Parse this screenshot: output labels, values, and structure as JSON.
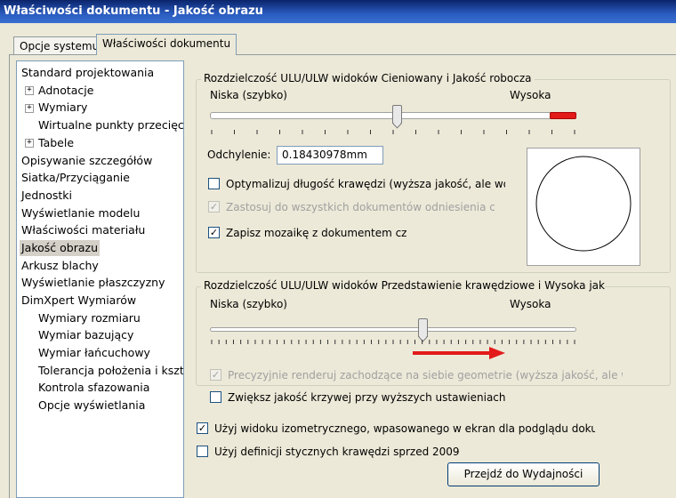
{
  "window": {
    "title": "Właściwości dokumentu - Jakość obrazu"
  },
  "tabs": [
    {
      "label": "Opcje systemu"
    },
    {
      "label": "Właściwości dokumentu"
    }
  ],
  "tree": {
    "items": [
      {
        "label": "Standard projektowania"
      },
      {
        "label": "Adnotacje"
      },
      {
        "label": "Wymiary"
      },
      {
        "label": "Wirtualne punkty przecięcia"
      },
      {
        "label": "Tabele"
      },
      {
        "label": "Opisywanie szczegółów"
      },
      {
        "label": "Siatka/Przyciąganie"
      },
      {
        "label": "Jednostki"
      },
      {
        "label": "Wyświetlanie modelu"
      },
      {
        "label": "Właściwości materiału"
      },
      {
        "label": "Jakość obrazu"
      },
      {
        "label": "Arkusz blachy"
      },
      {
        "label": "Wyświetlanie płaszczyzny"
      },
      {
        "label": "DimXpert Wymiarów"
      },
      {
        "label": "Wymiary rozmiaru"
      },
      {
        "label": "Wymiar bazujący"
      },
      {
        "label": "Wymiar łańcuchowy"
      },
      {
        "label": "Tolerancja położenia i kształtu"
      },
      {
        "label": "Kontrola sfazowania"
      },
      {
        "label": "Opcje wyświetlania"
      }
    ],
    "expander_plus": "+"
  },
  "shaded": {
    "title": "Rozdzielczość ULU/ULW widoków Cieniowany i Jakość robocza",
    "low_label": "Niska (szybko)",
    "high_label": "Wysoka",
    "slider_level": 0.55,
    "deviation_label": "Odchylenie:",
    "deviation_value": "0.18430978mm",
    "optimize_label": "Optymalizuj długość krawędzi (wyższa jakość, ale wolniej)",
    "optimize_checked": "",
    "apply_all_label": "Zastosuj do wszystkich dokumentów odniesienia części",
    "apply_all_checked": "✓",
    "save_tess_label": "Zapisz mozaikę z dokumentem części",
    "save_tess_checked": "✓"
  },
  "wireframe": {
    "title": "Rozdzielczość ULU/ULW widoków Przedstawienie krawędziowe i Wysoka jakość",
    "low_label": "Niska (szybko)",
    "high_label": "Wysoka",
    "slider_level": 0.58,
    "precise_label": "Precyzyjnie renderuj zachodzące na siebie geometrie (wyższa jakość, ale wolniej)",
    "precise_checked": "✓",
    "curve_quality_label": "Zwiększ jakość krzywej przy wyższych ustawieniach",
    "curve_quality_checked": ""
  },
  "bottom": {
    "iso_label": "Użyj widoku izometrycznego, wpasowanego w ekran dla podglądu dokumentu",
    "iso_checked": "✓",
    "tangent_label": "Użyj definicji stycznych krawędzi sprzed 2009",
    "tangent_checked": "",
    "perf_button": "Przejdź do Wydajności"
  },
  "colors": {
    "accent_red": "#e31a1a",
    "title_bar": "#0a246a"
  }
}
